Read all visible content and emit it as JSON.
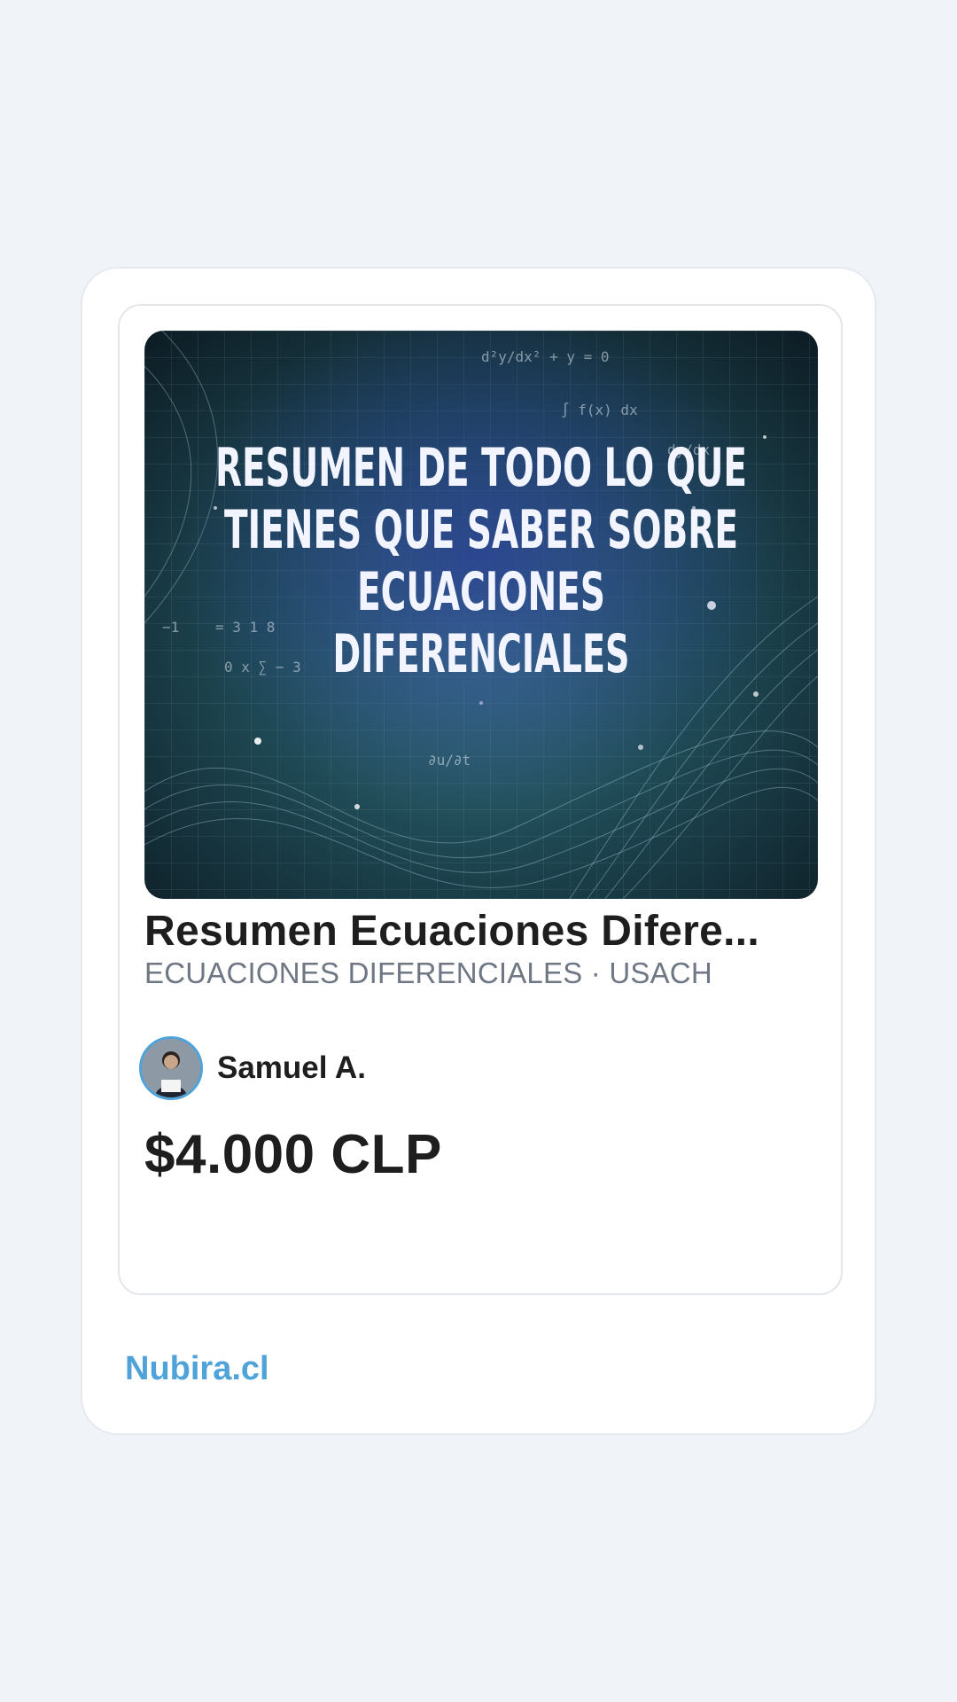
{
  "product": {
    "cover_title_lines": [
      "RESUMEN DE TODO LO QUE",
      "TIENES QUE SABER SOBRE",
      "ECUACIONES",
      "DIFERENCIALES"
    ],
    "title": "Resumen Ecuaciones Difere...",
    "meta": "ECUACIONES DIFERENCIALES · USACH",
    "price": "$4.000 CLP"
  },
  "seller": {
    "name": "Samuel A."
  },
  "footer": {
    "brand": "Nubira.cl"
  },
  "colors": {
    "accent": "#4fa3d8",
    "background": "#f0f4f8",
    "text": "#1e1e1e",
    "muted": "#6f7785"
  }
}
